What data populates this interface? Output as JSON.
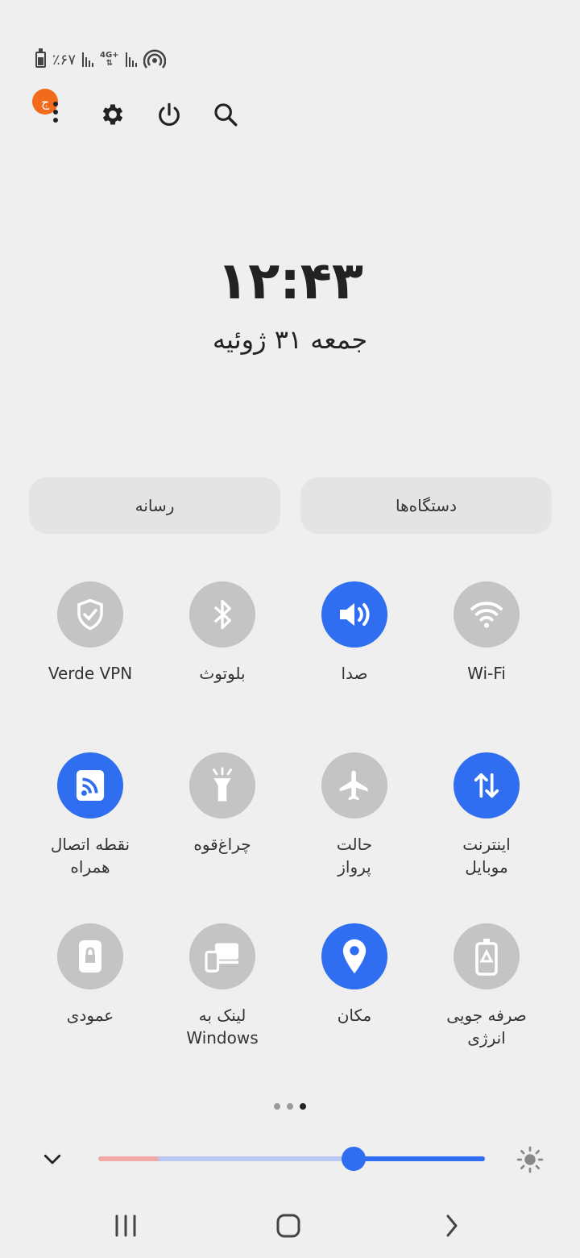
{
  "status_bar": {
    "battery": "٪۶۷",
    "network_type": "4G+"
  },
  "notification_badge": "ج",
  "clock": {
    "time": "۱۲:۴۳",
    "date": "جمعه ۳۱ ژوئیه"
  },
  "panels": {
    "devices": "دستگاه‌ها",
    "media": "رسانه"
  },
  "tiles": [
    {
      "label": "Wi-Fi",
      "label2": "",
      "icon": "wifi-icon",
      "active": false
    },
    {
      "label": "صدا",
      "label2": "",
      "icon": "sound-icon",
      "active": true
    },
    {
      "label": "بلوتوث",
      "label2": "",
      "icon": "bluetooth-icon",
      "active": false
    },
    {
      "label": "Verde VPN",
      "label2": "",
      "icon": "vpn-shield-icon",
      "active": false
    },
    {
      "label": "اینترنت",
      "label2": "موبایل",
      "icon": "mobile-data-icon",
      "active": true
    },
    {
      "label": "حالت",
      "label2": "پرواز",
      "icon": "airplane-icon",
      "active": false
    },
    {
      "label": "چراغ‌قوه",
      "label2": "",
      "icon": "flashlight-icon",
      "active": false
    },
    {
      "label": "نقطه اتصال",
      "label2": "همراه",
      "icon": "hotspot-icon",
      "active": true
    },
    {
      "label": "صرفه جویی",
      "label2": "انرژی",
      "icon": "power-saving-icon",
      "active": false
    },
    {
      "label": "مکان",
      "label2": "",
      "icon": "location-icon",
      "active": true
    },
    {
      "label": "لینک به",
      "label2": "Windows",
      "icon": "link-to-windows-icon",
      "active": false
    },
    {
      "label": "عمودی",
      "label2": "",
      "icon": "portrait-lock-icon",
      "active": false
    }
  ],
  "page_indicator": {
    "total": 3,
    "current": 3
  },
  "brightness": {
    "level": 0.66
  },
  "colors": {
    "accent": "#2f6ef0",
    "inactive": "#c4c4c4",
    "badge": "#f26a1b"
  }
}
